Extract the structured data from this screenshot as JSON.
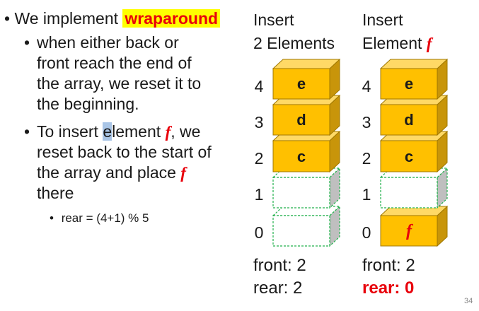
{
  "bullets": {
    "b1_pre": "We implement ",
    "b1_word": "wraparound",
    "b2_lines": [
      "when either back or",
      "front reach the end of",
      "the array, we reset it to",
      "the beginning."
    ],
    "b3_line1_a": "To insert ",
    "b3_line1_e": "e",
    "b3_line1_b": "lement ",
    "b3_line1_f": "f",
    "b3_line1_c": ", we",
    "b3_line2": "reset back to the start of",
    "b3_line3_a": "the array and place ",
    "b3_line3_f": "f",
    "b3_line4": "there",
    "b4": "rear = (4+1) % 5"
  },
  "left_array": {
    "header1": "Insert",
    "header2": "2 Elements",
    "indices": [
      "4",
      "3",
      "2",
      "1",
      "0"
    ],
    "cells": [
      "e",
      "d",
      "c",
      "",
      ""
    ],
    "front": "front: 2",
    "rear": "rear: 2"
  },
  "right_array": {
    "header1": "Insert",
    "header2_a": "Element ",
    "header2_f": "f",
    "indices": [
      "4",
      "3",
      "2",
      "1",
      "0"
    ],
    "cells": [
      "e",
      "d",
      "c",
      "",
      "f"
    ],
    "front": "front: 2",
    "rear": "rear: 0"
  },
  "colors": {
    "filled_front": "#ffc000",
    "filled_top": "#ffd966",
    "filled_side": "#c8950a",
    "empty_border": "#22b14c",
    "empty_side": "#bfbfbf",
    "highlight_red": "#e8000b"
  },
  "page_number": "34"
}
